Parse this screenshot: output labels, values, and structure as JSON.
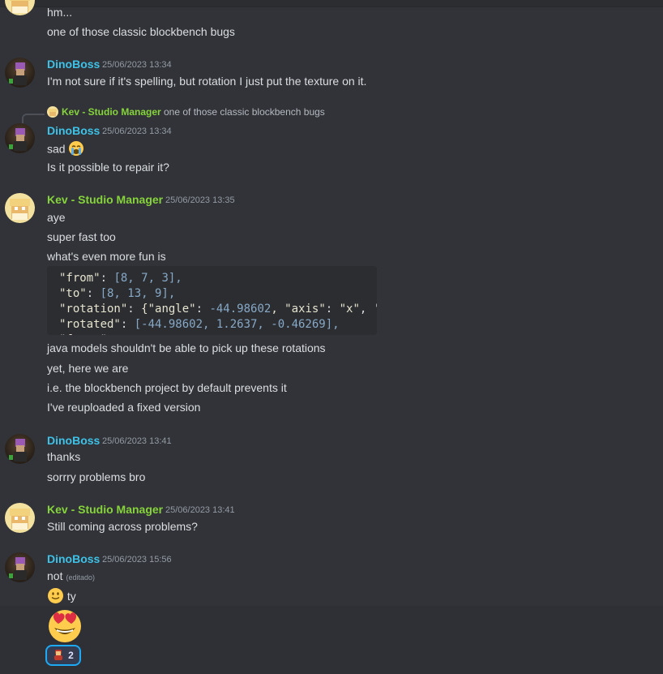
{
  "messages": {
    "m0": {
      "line1": "hm...",
      "line2": "one of those classic blockbench bugs"
    },
    "m1": {
      "author": "DinoBoss",
      "timestamp": "25/06/2023 13:34",
      "text": "I'm not sure if it's spelling, but rotation I just put the texture on it."
    },
    "reply": {
      "author": "Kev - Studio Manager",
      "text": "one of those classic blockbench bugs"
    },
    "m2": {
      "author": "DinoBoss",
      "timestamp": "25/06/2023 13:34",
      "line1": "sad",
      "line2": "Is it possible to repair it?"
    },
    "m3": {
      "author": "Kev - Studio Manager",
      "timestamp": "25/06/2023 13:35",
      "line1": "aye",
      "line2": "super fast too",
      "line3": "what's even more fun is",
      "code": {
        "l1": {
          "key": "\"from\"",
          "vals": "[8, 7, 3],",
          "tail": ""
        },
        "l2": {
          "key": "\"to\"",
          "vals": "[8, 13, 9],",
          "tail": ""
        },
        "l3": {
          "key": "\"rotation\"",
          "pre": "{\"angle\"",
          "num": "-44.98602",
          "mid": ", \"axis\"",
          "str": "\"x\"",
          "end": ", '"
        },
        "l4": {
          "key": "\"rotated\"",
          "vals": "[-44.98602, 1.2637, -0.46269],",
          "tail": ""
        },
        "l5": {
          "key": "\"faces\"",
          "vals": ":",
          "tail": ""
        }
      },
      "line4": "java models shouldn't be able to pick up these rotations",
      "line5": "yet, here we are",
      "line6": "i.e. the blockbench project by default prevents it",
      "line7": "I've reuploaded a fixed version"
    },
    "m4": {
      "author": "DinoBoss",
      "timestamp": "25/06/2023 13:41",
      "line1": "thanks",
      "line2": "sorrry problems bro"
    },
    "m5": {
      "author": "Kev - Studio Manager",
      "timestamp": "25/06/2023 13:41",
      "line1": "Still coming across problems?"
    },
    "m6": {
      "author": "DinoBoss",
      "timestamp": "25/06/2023 15:56",
      "line1": "not",
      "edited": "(editado)",
      "line2": "ty",
      "reaction_count": "2"
    }
  },
  "colors": {
    "background": "#313338",
    "dino_name": "#3ec2e8",
    "kev_name": "#86d43b",
    "reaction_border": "#1ea9f5"
  },
  "icons": [
    "dino-avatar-icon",
    "kev-avatar-icon",
    "crying-face-emoji",
    "slightly-smiling-face-emoji",
    "heart-eyes-emoji",
    "reaction-person-emoji"
  ]
}
